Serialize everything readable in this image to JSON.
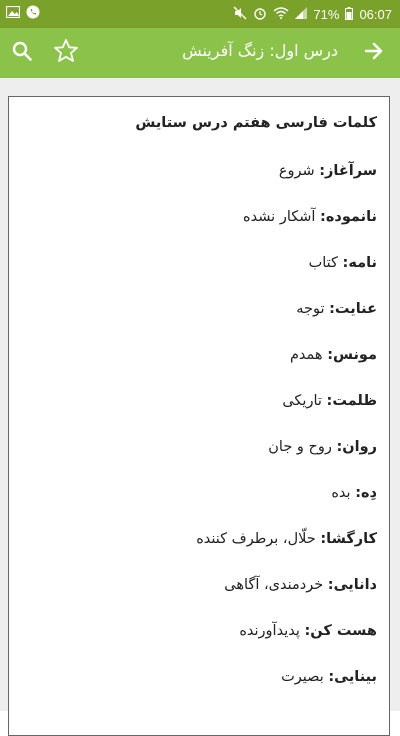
{
  "status_bar": {
    "battery": "71%",
    "time": "06:07",
    "colors": {
      "background": "#7aa12a"
    }
  },
  "app_bar": {
    "title": "درس اول: زنگ آفرینش",
    "back_icon": "arrow-right-icon",
    "search_icon": "search-icon",
    "favorite_icon": "star-outline-icon",
    "colors": {
      "background": "#8bc34a",
      "foreground": "#ffffff"
    }
  },
  "content": {
    "heading": "کلمات فارسی هفتم درس ستایش",
    "entries": [
      {
        "term": "سرآغاز:",
        "meaning": " شروع"
      },
      {
        "term": "نانموده:",
        "meaning": " آشکار نشده"
      },
      {
        "term": "نامه:",
        "meaning": " کتاب"
      },
      {
        "term": "عنایت:",
        "meaning": " توجه"
      },
      {
        "term": "مونس:",
        "meaning": " همدم"
      },
      {
        "term": "ظلمت:",
        "meaning": " تاریکی"
      },
      {
        "term": "روان:",
        "meaning": " روح و جان"
      },
      {
        "term": "دِه:",
        "meaning": " بده"
      },
      {
        "term": "کارگشا:",
        "meaning": " حلّال، برطرف کننده"
      },
      {
        "term": "دانایی:",
        "meaning": " خردمندی، آگاهی"
      },
      {
        "term": "هست کن:",
        "meaning": " پدیدآورنده"
      },
      {
        "term": "بینایی:",
        "meaning": " بصیرت"
      }
    ]
  }
}
